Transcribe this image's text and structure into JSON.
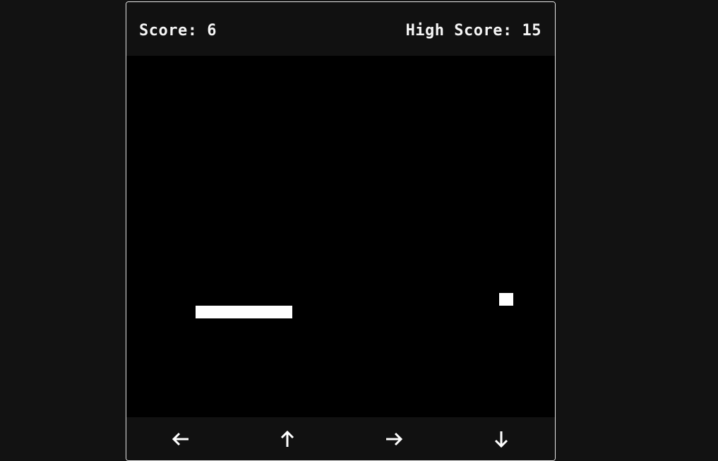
{
  "header": {
    "score_label": "Score: 6",
    "high_score_label": "High Score: 15"
  },
  "game": {
    "score": 6,
    "high_score": 15,
    "direction": "horizontal",
    "snake_length_cells": 7,
    "colors": {
      "page_background": "#121212",
      "panel": "#111111",
      "board": "#000000",
      "snake": "#ffffff",
      "food": "#ffffff",
      "text": "#f5f5f5"
    }
  },
  "controls": [
    {
      "name": "left",
      "icon": "arrow-left-icon"
    },
    {
      "name": "up",
      "icon": "arrow-up-icon"
    },
    {
      "name": "right",
      "icon": "arrow-right-icon"
    },
    {
      "name": "down",
      "icon": "arrow-down-icon"
    }
  ]
}
